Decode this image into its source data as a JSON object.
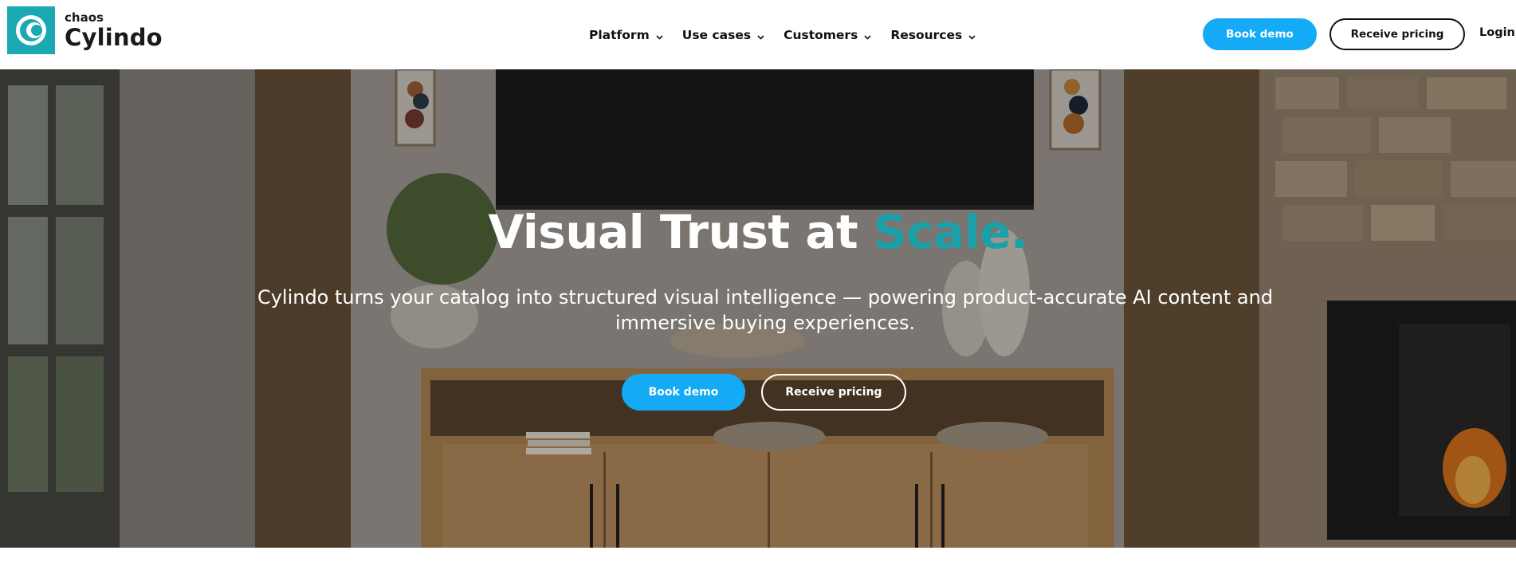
{
  "brand": {
    "name_small": "chaos",
    "name_large": "Cylindo",
    "logo_icon": "cylindo-logo-icon",
    "color": "#1aa8b3"
  },
  "nav": {
    "items": [
      {
        "label": "Platform",
        "icon": "chevron-down-icon"
      },
      {
        "label": "Use cases",
        "icon": "chevron-down-icon"
      },
      {
        "label": "Customers",
        "icon": "chevron-down-icon"
      },
      {
        "label": "Resources",
        "icon": "chevron-down-icon"
      }
    ],
    "book_demo": "Book demo",
    "receive_pricing": "Receive pricing",
    "login": "Login"
  },
  "hero": {
    "title_main": "Visual Trust at ",
    "title_accent": "Scale.",
    "subtitle": "Cylindo turns your catalog into structured visual intelligence — powering product-accurate AI content and immersive buying experiences.",
    "book_demo": "Book demo",
    "receive_pricing": "Receive pricing",
    "background": "living-room-with-tv-and-wooden-sideboard"
  },
  "colors": {
    "primary_button": "#14aaf5",
    "accent_text": "#1aa0a8"
  }
}
